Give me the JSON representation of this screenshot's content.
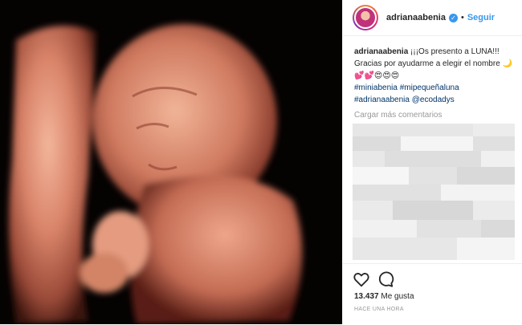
{
  "post": {
    "username": "adrianaabenia",
    "dot": "•",
    "follow_label": "Seguir",
    "caption": {
      "author": "adrianaabenia",
      "text_line1": "¡¡¡Os presento a LUNA!!!",
      "text_line2": "Gracias por ayudarme a elegir el nombre 🌙",
      "text_line3": "💕💕😍😍😍",
      "hashtag1": "#miniabenia",
      "hashtag2": "#mipequeñaluna",
      "hashtag3": "#adrianaabenia",
      "mention": "@ecodadys"
    },
    "load_more_label": "Cargar más comentarios",
    "likes_count": "13.437",
    "likes_label": "Me gusta",
    "timestamp": "HACE UNA HORA"
  },
  "icons": {
    "like": "heart-icon",
    "comment": "comment-icon",
    "verified": "verified-badge-icon"
  },
  "colors": {
    "link_blue": "#3897f0",
    "hashtag_blue": "#003569",
    "muted": "#999999",
    "text": "#262626"
  }
}
